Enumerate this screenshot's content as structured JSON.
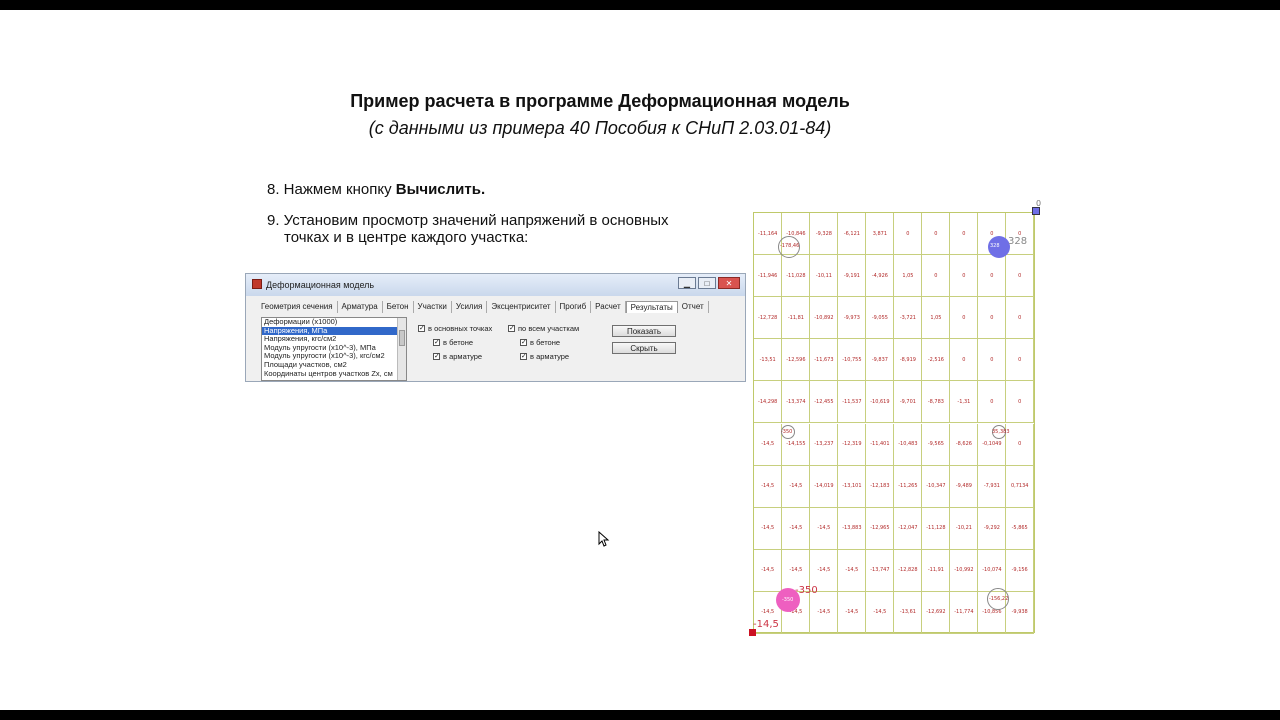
{
  "slide": {
    "title": "Пример расчета в программе Деформационная модель",
    "subtitle": "(с данными из примера 40 Пособия к СНиП 2.03.01-84)",
    "step8": {
      "prefix": "8.  Нажмем кнопку ",
      "bold": "Вычислить."
    },
    "step9": {
      "line1": "9.  Установим просмотр значений напряжений в основных",
      "line2": "точках и в центре каждого участка:"
    }
  },
  "window": {
    "title": "Деформационная модель",
    "controls": {
      "min": "▁",
      "max": "□",
      "close": "✕"
    },
    "tabs": [
      "Геометрия сечения",
      "Арматура",
      "Бетон",
      "Участки",
      "Усилия",
      "Эксцентриситет",
      "Прогиб",
      "Расчет",
      "Результаты",
      "Отчет"
    ],
    "active_tab": 8,
    "list": [
      "Деформации (x1000)",
      "Напряжения, МПа",
      "Напряжения, кгс/см2",
      "Модуль упругости (x10^-3), МПа",
      "Модуль упругости (x10^-3), кгс/см2",
      "Площади участков, см2",
      "Координаты центров участков Zx, см"
    ],
    "selected_index": 1,
    "check_main_points": "в основных точках",
    "check_all_sections": "по всем участкам",
    "in_concrete": "в бетоне",
    "in_rebar": "в арматуре",
    "in_concrete2": "в бетоне",
    "in_rebar2": "в арматуре",
    "btn_show": "Показать",
    "btn_hide": "Скрыть",
    "checkmark": "✓"
  },
  "grid": {
    "rows": [
      [
        "-11,164",
        "-10,846",
        "-9,328",
        "-6,121",
        "3,871",
        "0",
        "0",
        "0",
        "0",
        "0"
      ],
      [
        "-11,946",
        "-11,028",
        "-10,11",
        "-9,191",
        "-4,926",
        "1,05",
        "0",
        "0",
        "0",
        "0"
      ],
      [
        "-12,728",
        "-11,81",
        "-10,892",
        "-9,973",
        "-9,055",
        "-3,721",
        "1,05",
        "0",
        "0",
        "0"
      ],
      [
        "-13,51",
        "-12,596",
        "-11,673",
        "-10,755",
        "-9,837",
        "-8,919",
        "-2,516",
        "0",
        "0",
        "0"
      ],
      [
        "-14,298",
        "-13,374",
        "-12,455",
        "-11,537",
        "-10,619",
        "-9,701",
        "-8,783",
        "-1,31",
        "0",
        "0"
      ],
      [
        "-14,5",
        "-14,155",
        "-13,237",
        "-12,319",
        "-11,401",
        "-10,483",
        "-9,565",
        "-8,626",
        "-0,1049",
        "0"
      ],
      [
        "-14,5",
        "-14,5",
        "-14,019",
        "-13,101",
        "-12,183",
        "-11,265",
        "-10,347",
        "-9,489",
        "-7,931",
        "0,7134"
      ],
      [
        "-14,5",
        "-14,5",
        "-14,5",
        "-13,883",
        "-12,965",
        "-12,047",
        "-11,128",
        "-10,21",
        "-9,292",
        "-5,865"
      ],
      [
        "-14,5",
        "-14,5",
        "-14,5",
        "-14,5",
        "-13,747",
        "-12,828",
        "-11,91",
        "-10,992",
        "-10,074",
        "-9,156"
      ],
      [
        "-14,5",
        "-14,5",
        "-14,5",
        "-14,5",
        "-14,5",
        "-13,61",
        "-12,692",
        "-11,774",
        "-10,856",
        "-9,938"
      ]
    ],
    "annotations": {
      "top_right_zero": "0",
      "rebar_tl": "-178,46",
      "rebar_tr": "328",
      "rebar_tr_small": "328",
      "rebar_mid_l": "-350",
      "rebar_mid_r": "35,383",
      "rebar_bl": "-350",
      "rebar_bl_big": "-350",
      "rebar_br": "-156,22",
      "bottom_left_val": "-14,5"
    },
    "colors": {
      "grid": "#c7cf7e",
      "value": "#b22a2a",
      "blue_rebar": "#6f6fe6",
      "pink_rebar": "#ee5fc0",
      "corner_marker": "#cc1122"
    }
  }
}
